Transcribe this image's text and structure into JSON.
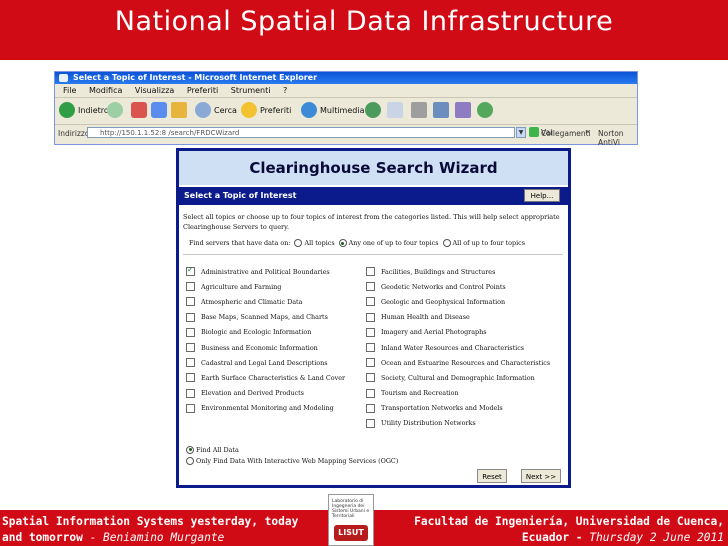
{
  "slide_title": "National Spatial Data Infrastructure",
  "browser": {
    "window_title": "Select a Topic of Interest - Microsoft Internet Explorer",
    "menu": [
      "File",
      "Modifica",
      "Visualizza",
      "Preferiti",
      "Strumenti",
      "?"
    ],
    "toolbar": {
      "back": "Indietro",
      "search": "Cerca",
      "favorites": "Preferiti",
      "media": "Multimedia"
    },
    "address_label": "Indirizzo",
    "address_value": "http://150.1.1.52:8 /search/FRDCWizard",
    "go_label": "Vai",
    "links_label": "Collegamenti",
    "links_chevron": "»",
    "norton_label": "Norton AntiVi"
  },
  "wizard": {
    "title": "Clearinghouse Search Wizard",
    "topic_header": "Select a Topic of Interest",
    "help_label": "Help...",
    "instructions": "Select all topics or choose up to four topics of interest from the categories listed. This will help select appropriate Clearinghouse Servers to query.",
    "find_label": "Find servers that have data on:",
    "find_options": [
      "All topics",
      "Any one of up to four topics",
      "All of up to four topics"
    ],
    "topics_left": [
      {
        "label": "Administrative and Political Boundaries",
        "checked": true
      },
      {
        "label": "Agriculture and Farming",
        "checked": false
      },
      {
        "label": "Atmospheric and Climatic Data",
        "checked": false
      },
      {
        "label": "Base Maps, Scanned Maps, and Charts",
        "checked": false
      },
      {
        "label": "Biologic and Ecologic Information",
        "checked": false
      },
      {
        "label": "Business and Economic Information",
        "checked": false
      },
      {
        "label": "Cadastral and Legal Land Descriptions",
        "checked": false
      },
      {
        "label": "Earth Surface Characteristics & Land Cover",
        "checked": false
      },
      {
        "label": "Elevation and Derived Products",
        "checked": false
      },
      {
        "label": "Environmental Monitoring and Modeling",
        "checked": false
      }
    ],
    "topics_right": [
      {
        "label": "Facilities, Buildings and Structures",
        "checked": false
      },
      {
        "label": "Geodetic Networks and Control Points",
        "checked": false
      },
      {
        "label": "Geologic and Geophysical Information",
        "checked": false
      },
      {
        "label": "Human Health and Disease",
        "checked": false
      },
      {
        "label": "Imagery and Aerial Photographs",
        "checked": false
      },
      {
        "label": "Inland Water Resources and Characteristics",
        "checked": false
      },
      {
        "label": "Ocean and Estuarine Resources and Characteristics",
        "checked": false
      },
      {
        "label": "Society, Cultural and Demographic Information",
        "checked": false
      },
      {
        "label": "Tourism and Recreation",
        "checked": false
      },
      {
        "label": "Transportation Networks and Models",
        "checked": false
      },
      {
        "label": "Utility Distribution Networks",
        "checked": false
      }
    ],
    "data_options": [
      "Find All Data",
      "Only Find Data With Interactive Web Mapping Services (OGC)"
    ],
    "reset_label": "Reset",
    "next_label": "Next >>"
  },
  "footer": {
    "left_line1": "Spatial Information Systems yesterday, today",
    "left_line2_bold": "and tomorrow",
    "left_line2_light": "- Beniamino Murgante",
    "right_line1": "Facultad de Ingeniería, Universidad de Cuenca,",
    "right_line2_bold": "Ecuador -",
    "right_line2_light": "Thursday 2 June 2011",
    "logo_text": "Laboratorio di Ingegneria dei Sistemi Urbani e Territoriali",
    "logo_mark": "LISUT"
  }
}
